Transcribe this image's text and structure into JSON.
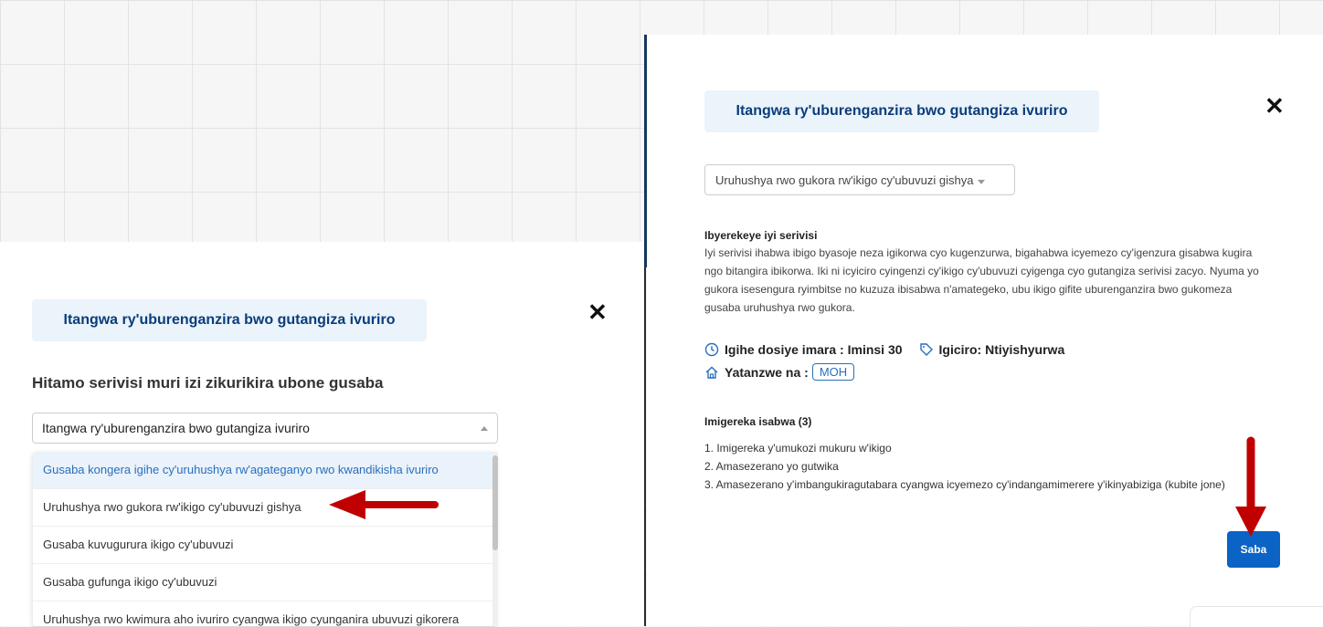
{
  "left_modal": {
    "title": "Itangwa ry'uburenganzira bwo gutangiza ivuriro",
    "prompt": "Hitamo serivisi muri izi zikurikira ubone gusaba",
    "select_value": "Itangwa ry'uburenganzira bwo gutangiza ivuriro",
    "options": [
      "Gusaba kongera igihe cy'uruhushya rw'agateganyo rwo kwandikisha ivuriro",
      "Uruhushya rwo gukora rw'ikigo cy'ubuvuzi gishya",
      "Gusaba kuvugurura ikigo cy'ubuvuzi",
      "Gusaba gufunga ikigo cy'ubuvuzi",
      "Uruhushya rwo kwimura aho ivuriro cyangwa ikigo cyunganira ubuvuzi gikorera"
    ]
  },
  "right_modal": {
    "title": "Itangwa ry'uburenganzira bwo gutangiza ivuriro",
    "select_value": "Uruhushya rwo gukora rw'ikigo cy'ubuvuzi gishya",
    "desc_heading": "Ibyerekeye iyi serivisi",
    "desc_body": "Iyi serivisi ihabwa ibigo byasoje neza igikorwa cyo kugenzurwa, bigahabwa icyemezo cy'igenzura gisabwa kugira ngo bitangira ibikorwa. Iki ni icyiciro cyingenzi cy'ikigo cy'ubuvuzi cyigenga cyo gutangiza serivisi zacyo. Nyuma yo gukora isesengura ryimbitse no kuzuza ibisabwa n'amategeko, ubu ikigo gifite uburenganzira bwo gukomeza gusaba uruhushya rwo gukora.",
    "duration": "Igihe dosiye imara : Iminsi 30",
    "price": "Igiciro: Ntiyishyurwa",
    "provider_label": "Yatanzwe na :",
    "provider": "MOH",
    "requirements_heading": "Imigereka isabwa (3)",
    "requirements": [
      "1. Imigereka y'umukozi mukuru w'ikigo",
      "2. Amasezerano yo gutwika",
      "3. Amasezerano y'imbangukiragutabara cyangwa icyemezo cy'indangamimerere y'ikinyabiziga (kubite jone)"
    ],
    "submit_label": "Saba"
  },
  "colors": {
    "accent": "#0a63c5",
    "badge_bg": "#ebf3fb",
    "arrow": "#c00000"
  }
}
